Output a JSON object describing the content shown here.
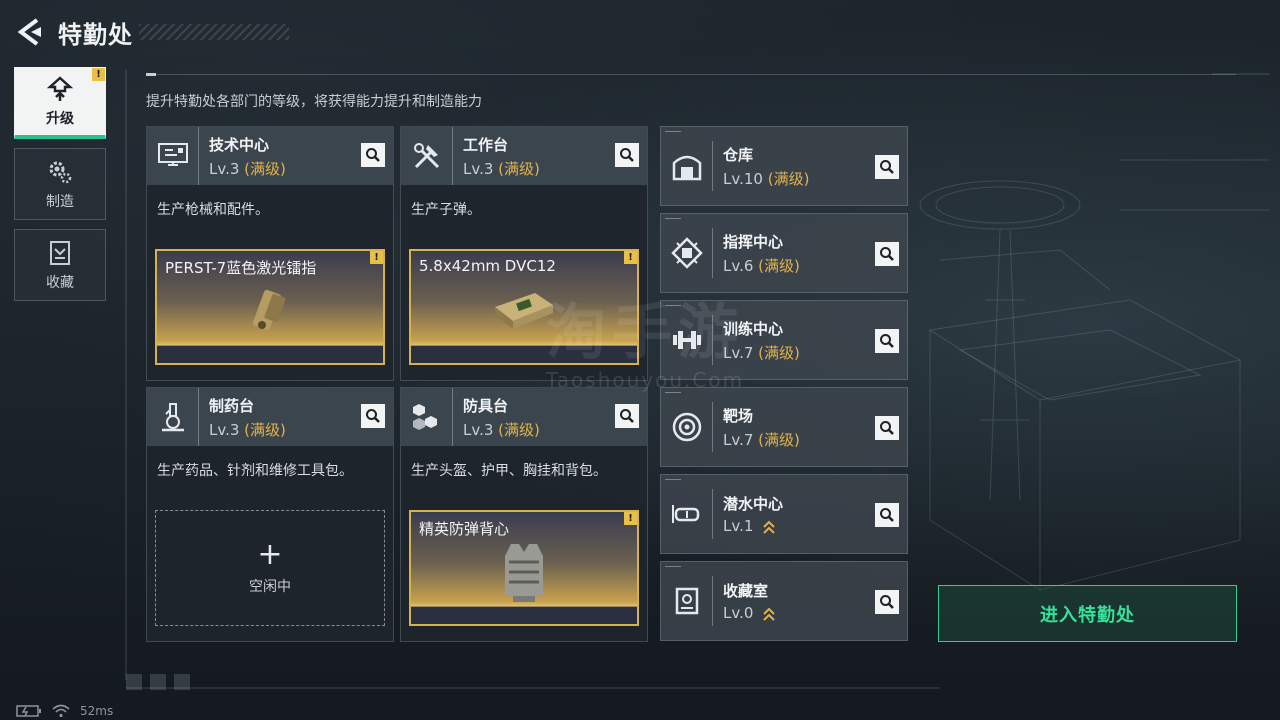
{
  "header": {
    "title": "特勤处"
  },
  "sidenav": {
    "items": [
      {
        "label": "升级",
        "icon": "upgrade-icon",
        "active": true,
        "badge": "!"
      },
      {
        "label": "制造",
        "icon": "gears-icon",
        "active": false
      },
      {
        "label": "收藏",
        "icon": "collection-icon",
        "active": false
      }
    ]
  },
  "subtitle": "提升特勤处各部门的等级，将获得能力提升和制造能力",
  "left_cards": [
    {
      "name": "技术中心",
      "lv": "Lv.3",
      "max": "(满级)",
      "desc": "生产枪械和配件。",
      "icon": "tech-center-icon",
      "slot": {
        "name": "PERST-7蓝色激光镭指",
        "badge": "!",
        "art": "laser-sight-image"
      }
    },
    {
      "name": "工作台",
      "lv": "Lv.3",
      "max": "(满级)",
      "desc": "生产子弹。",
      "icon": "workbench-tools-icon",
      "slot": {
        "name": "5.8x42mm DVC12",
        "badge": "!",
        "art": "ammo-box-image"
      }
    },
    {
      "name": "制药台",
      "lv": "Lv.3",
      "max": "(满级)",
      "desc": "生产药品、针剂和维修工具包。",
      "icon": "microscope-icon",
      "empty": {
        "plus": "+",
        "label": "空闲中"
      }
    },
    {
      "name": "防具台",
      "lv": "Lv.3",
      "max": "(满级)",
      "desc": "生产头盔、护甲、胸挂和背包。",
      "icon": "armor-cubes-icon",
      "slot": {
        "name": "精英防弹背心",
        "badge": "!",
        "art": "armor-vest-image"
      }
    }
  ],
  "right_cards": [
    {
      "name": "仓库",
      "lv": "Lv.10",
      "max": "(满级)",
      "icon": "warehouse-icon"
    },
    {
      "name": "指挥中心",
      "lv": "Lv.6",
      "max": "(满级)",
      "icon": "command-chip-icon"
    },
    {
      "name": "训练中心",
      "lv": "Lv.7",
      "max": "(满级)",
      "icon": "dumbbell-icon"
    },
    {
      "name": "靶场",
      "lv": "Lv.7",
      "max": "(满级)",
      "icon": "target-icon"
    },
    {
      "name": "潜水中心",
      "lv": "Lv.1",
      "max": "",
      "icon": "diving-goggles-icon",
      "upgradable": true
    },
    {
      "name": "收藏室",
      "lv": "Lv.0",
      "max": "",
      "icon": "collection-room-icon",
      "upgradable": true
    }
  ],
  "enter_button": {
    "label": "进入特勤处"
  },
  "watermark": {
    "cn": "淘手游",
    "en": "Taoshouyou.Com"
  },
  "status": {
    "ping": "52ms"
  },
  "colors": {
    "accent_green": "#38e09a",
    "gold": "#e2b24a",
    "badge": "#e8c048"
  }
}
